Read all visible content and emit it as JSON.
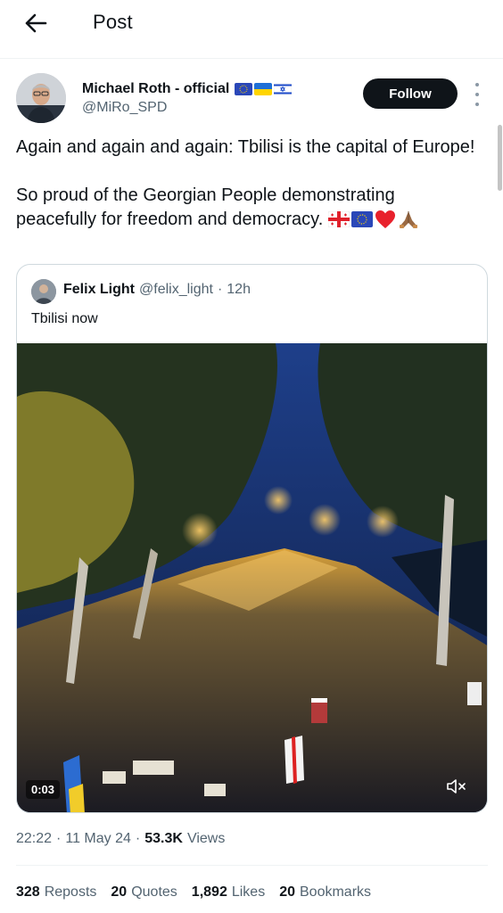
{
  "header": {
    "title": "Post"
  },
  "author": {
    "name": "Michael Roth - official",
    "handle": "@MiRo_SPD",
    "flags": [
      "eu-flag",
      "ukraine-flag",
      "israel-flag"
    ]
  },
  "actions": {
    "follow_label": "Follow"
  },
  "post": {
    "paragraph_1": "Again and again and again: Tbilisi is the capital of Europe!",
    "paragraph_2": "So proud of the Georgian People demonstrating peacefully for freedom and democracy.",
    "trailing_emoji": [
      "georgia-flag",
      "eu-flag",
      "red-heart",
      "folded-hands"
    ]
  },
  "quote": {
    "name": "Felix Light",
    "handle": "@felix_light",
    "separator": "·",
    "time": "12h",
    "text": "Tbilisi now",
    "video": {
      "duration": "0:03",
      "muted": true
    }
  },
  "meta": {
    "time": "22:22",
    "sep1": "·",
    "date": "11 May 24",
    "sep2": "·",
    "views_count": "53.3K",
    "views_label": "Views"
  },
  "stats": [
    {
      "count": "328",
      "label": "Reposts"
    },
    {
      "count": "20",
      "label": "Quotes"
    },
    {
      "count": "1,892",
      "label": "Likes"
    },
    {
      "count": "20",
      "label": "Bookmarks"
    }
  ],
  "colors": {
    "text": "#0f1419",
    "secondary": "#536471",
    "border": "#cfd9de",
    "follow_bg": "#0f1419"
  }
}
